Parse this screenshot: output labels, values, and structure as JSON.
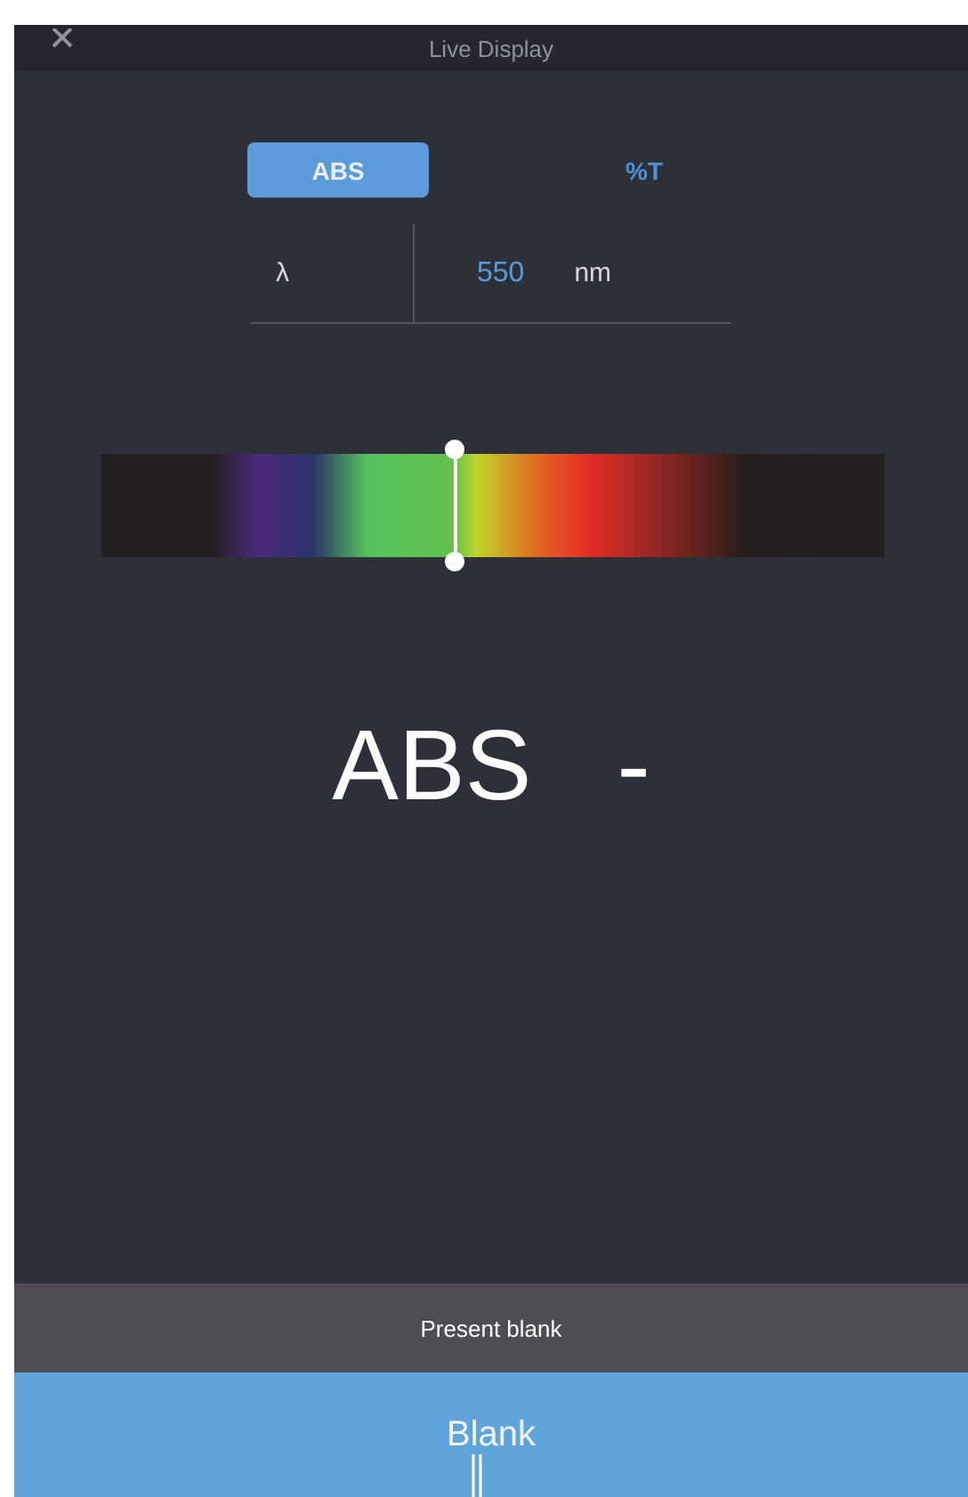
{
  "header": {
    "title": "Live Display"
  },
  "modes": [
    {
      "label": "ABS",
      "selected": true
    },
    {
      "label": "%T",
      "selected": false
    }
  ],
  "wavelength": {
    "symbol": "λ",
    "value": "550",
    "unit": "nm"
  },
  "spectrum": {
    "level": 0.452
  },
  "reading": {
    "label": "ABS",
    "value": "-"
  },
  "status": "Present blank",
  "action": "Blank"
}
